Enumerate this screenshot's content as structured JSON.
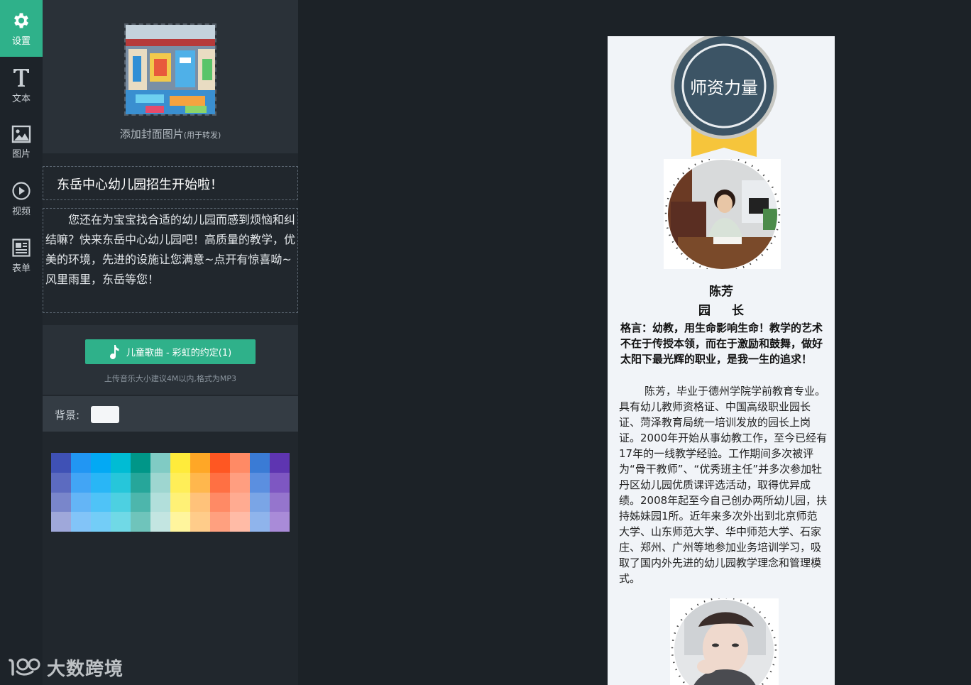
{
  "rail": {
    "items": [
      {
        "label": "设置",
        "icon": "gear-icon"
      },
      {
        "label": "文本",
        "icon": "text-icon"
      },
      {
        "label": "图片",
        "icon": "image-icon"
      },
      {
        "label": "视频",
        "icon": "play-icon"
      },
      {
        "label": "表单",
        "icon": "form-icon"
      }
    ],
    "active_color": "#2fb18a"
  },
  "settings": {
    "cover_label": "添加封面图片",
    "cover_note": "(用于转发)",
    "title": "东岳中心幼儿园招生开始啦！",
    "description": "您还在为宝宝找合适的幼儿园而感到烦恼和纠结嘛？快来东岳中心幼儿园吧！高质量的教学，优美的环境，先进的设施让您满意~点开有惊喜呦~风里雨里，东岳等您！",
    "music_label": "儿童歌曲 - 彩虹的约定(1)",
    "music_hint": "上传音乐大小建议4M以内,格式为MP3",
    "background_label": "背景:",
    "background_color": "#f4f6f8"
  },
  "palette": [
    [
      "#3f51b5",
      "#2196f3",
      "#03a9f4",
      "#00bcd4",
      "#009688",
      "#80cbc4",
      "#ffeb3b",
      "#ffa726",
      "#ff5722",
      "#ff8a65",
      "#3a7bd5",
      "#5e35b1"
    ],
    [
      "#5c6bc0",
      "#42a5f5",
      "#29b6f6",
      "#26c6da",
      "#26a69a",
      "#9ed6d0",
      "#ffee58",
      "#ffb74d",
      "#ff7043",
      "#ff9e80",
      "#5b8fe0",
      "#7e57c2"
    ],
    [
      "#7986cb",
      "#64b5f6",
      "#4fc3f7",
      "#4dd0e1",
      "#4db6ac",
      "#b2dfdb",
      "#fff176",
      "#ffc27a",
      "#ff8a65",
      "#ffab91",
      "#7aa5e6",
      "#9575cd"
    ],
    [
      "#9fa8da",
      "#82c4f8",
      "#73cdf7",
      "#70d9e6",
      "#6fc4bb",
      "#c3e5e1",
      "#fff59d",
      "#ffcc8a",
      "#ffa07f",
      "#ffbba6",
      "#8fb4ec",
      "#a98bd8"
    ]
  ],
  "watermark": {
    "text": "大数跨境"
  },
  "preview": {
    "badge_text": "师资力量",
    "name": "陈芳",
    "role": "园 长",
    "motto": "格言：幼教，用生命影响生命！教学的艺术不在于传授本领，而在于激励和鼓舞，做好太阳下最光辉的职业，是我一生的追求！",
    "bio": "陈芳，毕业于德州学院学前教育专业。具有幼儿教师资格证、中国高级职业园长证、菏泽教育局统一培训发放的园长上岗证。2000年开始从事幼教工作，至今已经有17年的一线教学经验。工作期间多次被评为“骨干教师”、“优秀班主任”并多次参加牡丹区幼儿园优质课评选活动，取得优异成绩。2008年起至今自己创办两所幼儿园，扶持姊妹园1所。近年来多次外出到北京师范大学、山东师范大学、华中师范大学、石家庄、郑州、广州等地参加业务培训学习，吸取了国内外先进的幼儿园教学理念和管理模式。",
    "badge_color": "#3c5465",
    "ribbon_color": "#f6c53b"
  }
}
